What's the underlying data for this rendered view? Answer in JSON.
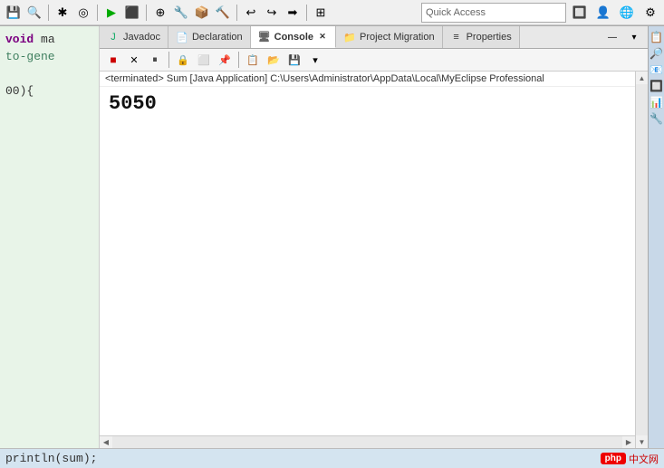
{
  "toolbar": {
    "quick_access_placeholder": "Quick Access",
    "quick_access_value": "Quick Access"
  },
  "tabs": [
    {
      "id": "javadoc",
      "label": "Javadoc",
      "icon": "J",
      "active": false,
      "closable": false
    },
    {
      "id": "declaration",
      "label": "Declaration",
      "icon": "D",
      "active": false,
      "closable": false
    },
    {
      "id": "console",
      "label": "Console",
      "icon": "C",
      "active": true,
      "closable": true
    },
    {
      "id": "project-migration",
      "label": "Project Migration",
      "icon": "P",
      "active": false,
      "closable": false
    },
    {
      "id": "properties",
      "label": "Properties",
      "icon": "≡",
      "active": false,
      "closable": false
    }
  ],
  "console": {
    "header": "<terminated> Sum [Java Application] C:\\Users\\Administrator\\AppData\\Local\\MyEclipse Professional",
    "output": "5050"
  },
  "code_lines": [
    {
      "text": "void ma",
      "type": "keyword_line"
    },
    {
      "text": "to-gene",
      "type": "comment_line"
    },
    {
      "text": "",
      "type": "empty"
    },
    {
      "text": "00){",
      "type": "normal"
    },
    {
      "text": "",
      "type": "empty"
    },
    {
      "text": "",
      "type": "empty"
    }
  ],
  "bottom": {
    "code_text": "println(sum);",
    "php_badge": "php",
    "cn_text": "中文网"
  },
  "side_icons": [
    "▶",
    "◀",
    "▼",
    "▲",
    "■"
  ],
  "colors": {
    "bg": "#d4e4f0",
    "toolbar_bg": "#f0f0f0",
    "tab_active_bg": "#ffffff",
    "tab_inactive_bg": "#e0e0e0",
    "console_bg": "#ffffff",
    "code_bg": "#e8f4e8",
    "php_red": "#cc0000"
  }
}
